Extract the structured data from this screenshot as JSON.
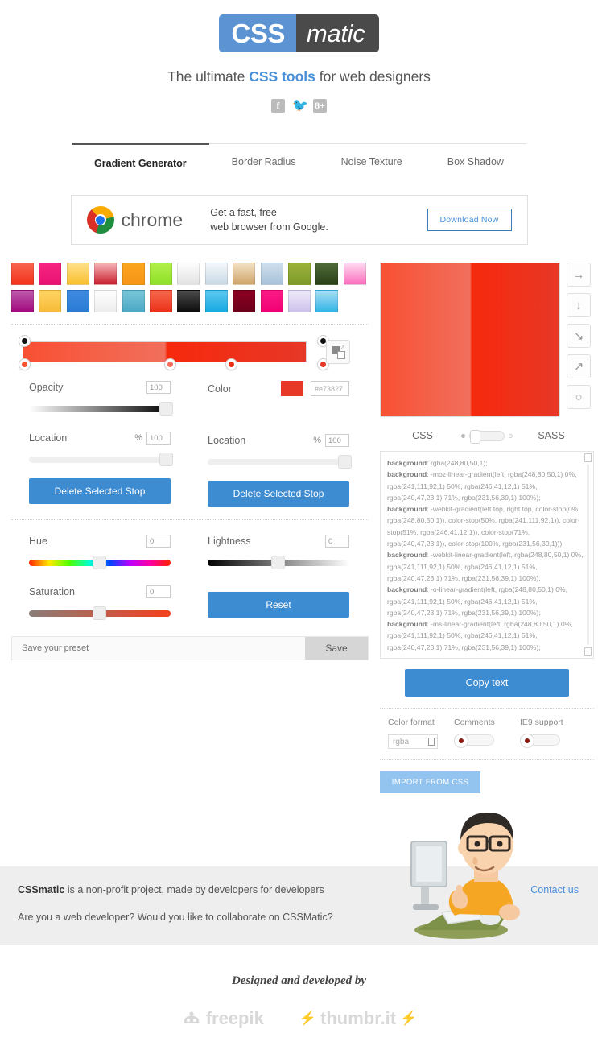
{
  "header": {
    "logo_css": "CSS",
    "logo_matic": "matic",
    "tagline_pre": "The ultimate ",
    "tagline_bold": "CSS tools",
    "tagline_post": " for web designers",
    "socials": [
      {
        "name": "facebook-icon",
        "glyph": "f"
      },
      {
        "name": "twitter-icon",
        "glyph": "ᴠ"
      },
      {
        "name": "googleplus-icon",
        "glyph": "8+"
      }
    ]
  },
  "tabs": [
    {
      "label": "Gradient Generator",
      "active": true
    },
    {
      "label": "Border Radius",
      "active": false
    },
    {
      "label": "Noise Texture",
      "active": false
    },
    {
      "label": "Box Shadow",
      "active": false
    }
  ],
  "ad": {
    "brand": "chrome",
    "line1": "Get a fast, free",
    "line2": "web browser from Google.",
    "button": "Download Now"
  },
  "swatches": [
    "linear-gradient(#f9634c,#f2331c)",
    "linear-gradient(#f72583,#e81272)",
    "linear-gradient(#ffe08a,#f9c02e)",
    "linear-gradient(#f6b2b8,#c8202c)",
    "linear-gradient(#fba51f,#f79416)",
    "linear-gradient(#b2f04a,#8ee029)",
    "linear-gradient(#fdfdfd,#e2e2e2)",
    "linear-gradient(#f4f8fb,#c8d9e5)",
    "linear-gradient(#f2e0c4,#cfa468)",
    "linear-gradient(#cfe0ee,#a7c2da)",
    "linear-gradient(#9bb23a,#7f9a2b)",
    "linear-gradient(#4f6b36,#2b4019)",
    "linear-gradient(#ffd9f0,#fa6ebd)",
    "linear-gradient(#bb5aab,#a3097f)",
    "linear-gradient(#ffd463,#f6bb38)",
    "linear-gradient(#3f8ae0,#2a7bd6)",
    "linear-gradient(#ffffff,#ededed)",
    "linear-gradient(#79c6d9,#4ba9c4)",
    "linear-gradient(#f4694c,#ec3119)",
    "linear-gradient(#4a4a4a,#0d0d0d)",
    "linear-gradient(#5ec9ef,#16a9e2)",
    "linear-gradient(#8d0023,#6b001a)",
    "linear-gradient(#fb1b86,#f10074)",
    "linear-gradient(#efeafb,#ccc2ea)",
    "linear-gradient(#a9ddf3,#33b6e8)"
  ],
  "gradient_bar": {
    "css": "linear-gradient(to right, rgb(248,80,50) 0%, rgb(241,111,92) 50%, rgb(246,41,12) 51%, rgb(240,47,23) 71%, rgb(231,56,39) 100%)",
    "opacity_stops": [
      {
        "pos": 0
      },
      {
        "pos": 100
      }
    ],
    "color_stops": [
      {
        "pos": 0,
        "color": "#f85032"
      },
      {
        "pos": 50,
        "color": "#f16f5c"
      },
      {
        "pos": 71,
        "color": "#f02f17"
      },
      {
        "pos": 100,
        "color": "#e73827"
      }
    ],
    "duplicate_icon": "duplicate-gradient-icon"
  },
  "controls": {
    "opacity": {
      "label": "Opacity",
      "value": "100",
      "knob_pct": 96
    },
    "color": {
      "label": "Color",
      "swatch": "#e73827",
      "hex": "#e73827"
    },
    "location_left": {
      "label": "Location",
      "unit": "%",
      "value": "100",
      "knob_pct": 96
    },
    "location_right": {
      "label": "Location",
      "unit": "%",
      "value": "100",
      "knob_pct": 96
    },
    "delete_left": "Delete Selected Stop",
    "delete_right": "Delete Selected Stop",
    "hue": {
      "label": "Hue",
      "value": "0",
      "knob_pct": 50
    },
    "saturation": {
      "label": "Saturation",
      "value": "0",
      "knob_pct": 50
    },
    "lightness": {
      "label": "Lightness",
      "value": "0",
      "knob_pct": 50
    },
    "reset": "Reset"
  },
  "preset": {
    "placeholder": "Save your preset",
    "save_label": "Save"
  },
  "directions": [
    {
      "name": "direction-right",
      "glyph": "→"
    },
    {
      "name": "direction-down",
      "glyph": "↓"
    },
    {
      "name": "direction-down-right",
      "glyph": "↘"
    },
    {
      "name": "direction-up-right",
      "glyph": "↗"
    },
    {
      "name": "direction-radial",
      "glyph": "○"
    }
  ],
  "output": {
    "lang_left": "CSS",
    "lang_right": "SASS",
    "selected": "CSS",
    "copy_label": "Copy text",
    "code": [
      {
        "prop": "background",
        "value": ": rgba(248,80,50,1);"
      },
      {
        "prop": "background",
        "value": ": -moz-linear-gradient(left, rgba(248,80,50,1) 0%, rgba(241,111,92,1) 50%, rgba(246,41,12,1) 51%, rgba(240,47,23,1) 71%, rgba(231,56,39,1) 100%);"
      },
      {
        "prop": "background",
        "value": ": -webkit-gradient(left top, right top, color-stop(0%, rgba(248,80,50,1)), color-stop(50%, rgba(241,111,92,1)), color-stop(51%, rgba(246,41,12,1)), color-stop(71%, rgba(240,47,23,1)), color-stop(100%, rgba(231,56,39,1)));"
      },
      {
        "prop": "background",
        "value": ": -webkit-linear-gradient(left, rgba(248,80,50,1) 0%, rgba(241,111,92,1) 50%, rgba(246,41,12,1) 51%, rgba(240,47,23,1) 71%, rgba(231,56,39,1) 100%);"
      },
      {
        "prop": "background",
        "value": ": -o-linear-gradient(left, rgba(248,80,50,1) 0%, rgba(241,111,92,1) 50%, rgba(246,41,12,1) 51%, rgba(240,47,23,1) 71%, rgba(231,56,39,1) 100%);"
      },
      {
        "prop": "background",
        "value": ": -ms-linear-gradient(left, rgba(248,80,50,1) 0%, rgba(241,111,92,1) 50%, rgba(246,41,12,1) 51%, rgba(240,47,23,1) 71%, rgba(231,56,39,1) 100%);"
      }
    ],
    "color_format": {
      "label": "Color format",
      "value": "rgba"
    },
    "comments": {
      "label": "Comments",
      "state": "off"
    },
    "ie9": {
      "label": "IE9 support",
      "state": "off"
    },
    "import_label": "IMPORT FROM CSS"
  },
  "footer": {
    "line1_bold": "CSSmatic",
    "line1_rest": " is a non-profit project, made by developers for developers",
    "line2": "Are you a web developer? Would you like to collaborate on CSSMatic?",
    "contact": "Contact us"
  },
  "credits": {
    "title": "Designed and developed by",
    "freepik": "freepik",
    "thumbrit": "thumbr.it"
  }
}
